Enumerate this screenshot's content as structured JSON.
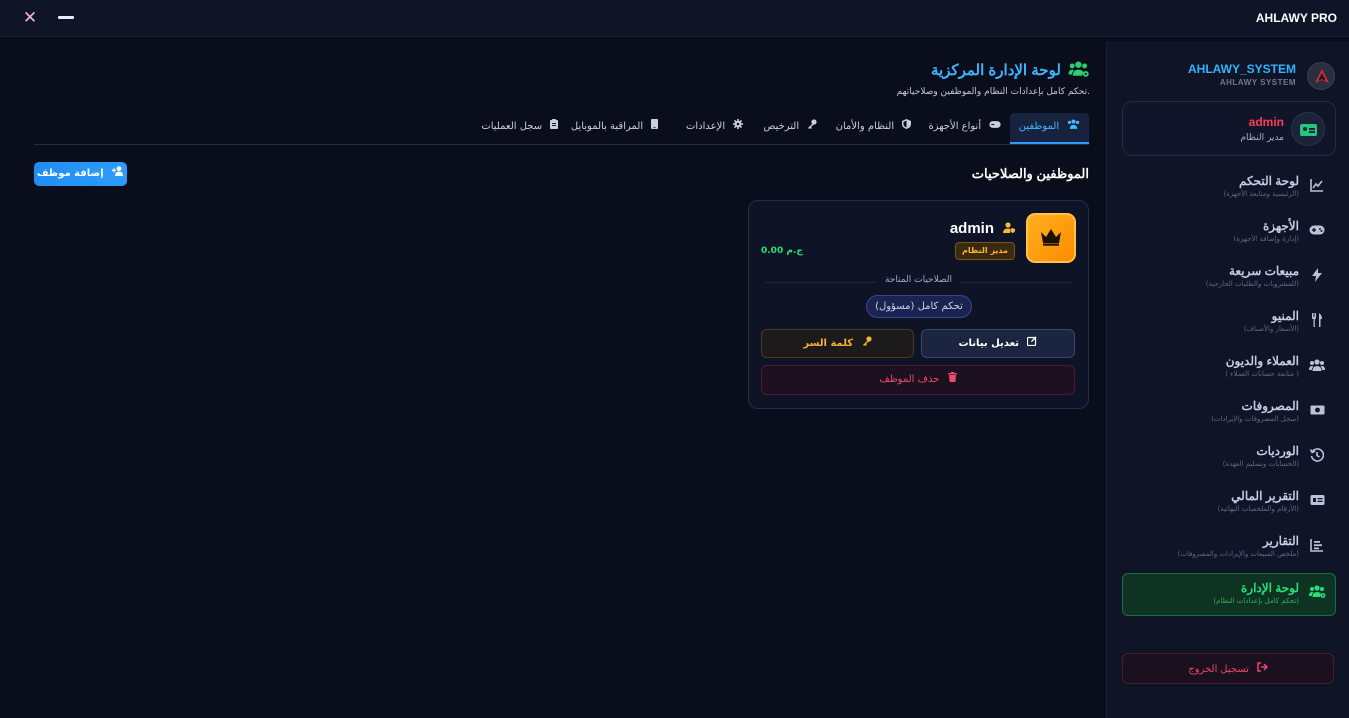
{
  "window": {
    "title": "AHLAWY PRO",
    "close_glyph": "✕"
  },
  "sidebar": {
    "brand_name": "AHLAWY_SYSTEM",
    "brand_sub": "AHLAWY SYSTEM",
    "user": {
      "name": "admin",
      "role": "مدير النظام"
    },
    "items": [
      {
        "label": "لوحة التحكم",
        "sub": "(الرئيسية ومتابعة الأجهزة)",
        "icon": "chart-line-icon",
        "glyph": "📈"
      },
      {
        "label": "الأجهزة",
        "sub": "(إدارة وإضافة الأجهزة)",
        "icon": "gamepad-icon",
        "glyph": "🎮"
      },
      {
        "label": "مبيعات سريعة",
        "sub": "(للمشروبات والطلبات الخارجية)",
        "icon": "bolt-icon",
        "glyph": "⚡"
      },
      {
        "label": "المنيو",
        "sub": "(الأسعار والأصناف)",
        "icon": "utensils-icon",
        "glyph": "🍴"
      },
      {
        "label": "العملاء والديون",
        "sub": "( متابعة حسابات العملاء )",
        "icon": "users-icon",
        "glyph": "👥"
      },
      {
        "label": "المصروفات",
        "sub": "(سجل المصروفات والإيرادات)",
        "icon": "money-icon",
        "glyph": "💵"
      },
      {
        "label": "الورديات",
        "sub": "(الحسابات وتسليم العهدة)",
        "icon": "history-icon",
        "glyph": "⟲"
      },
      {
        "label": "التقرير المالي",
        "sub": "(الأرقام والملخصات النهائية)",
        "icon": "id-card-icon",
        "glyph": "▤"
      },
      {
        "label": "التقارير",
        "sub": "(ملخص المبيعات والإيرادات والمصروفات)",
        "icon": "bar-chart-icon",
        "glyph": "▥"
      },
      {
        "label": "لوحة الإدارة",
        "sub": "(تحكم كامل بإعدادات النظام)",
        "icon": "users-cog-icon",
        "glyph": "👥"
      }
    ],
    "logout_label": "تسجيل الخروج"
  },
  "main": {
    "title": "لوحة الإدارة المركزية",
    "subtitle": "تحكم كامل بإعدادات النظام والموظفين وصلاحياتهم.",
    "tabs": [
      {
        "label": "الموظفين",
        "active": true
      },
      {
        "label": "أنواع الأجهزة",
        "active": false
      },
      {
        "label": "النظام والأمان",
        "active": false
      },
      {
        "label": "الترخيص",
        "active": false
      },
      {
        "label": "الإعدادات",
        "active": false
      },
      {
        "label": "المراقبة بالموبايل",
        "active": false
      },
      {
        "label": "سجل العمليات",
        "active": false
      }
    ],
    "section_title": "الموظفين والصلاحيات",
    "add_button": "إضافة موظف",
    "employee": {
      "name": "admin",
      "badge": "مدير النظام",
      "balance": "0.00 ج.م",
      "permissions_title": "الصلاحيات المتاحة",
      "permission_chip": "تحكم كامل (مسؤول)",
      "edit_label": "تعديل بيانات",
      "password_label": "كلمة السر",
      "delete_label": "حذف الموظف"
    }
  },
  "colors": {
    "accent_blue": "#2d9cff",
    "active_green": "#23e07a",
    "danger": "#ee4a6a",
    "gold": "#f3b233"
  }
}
